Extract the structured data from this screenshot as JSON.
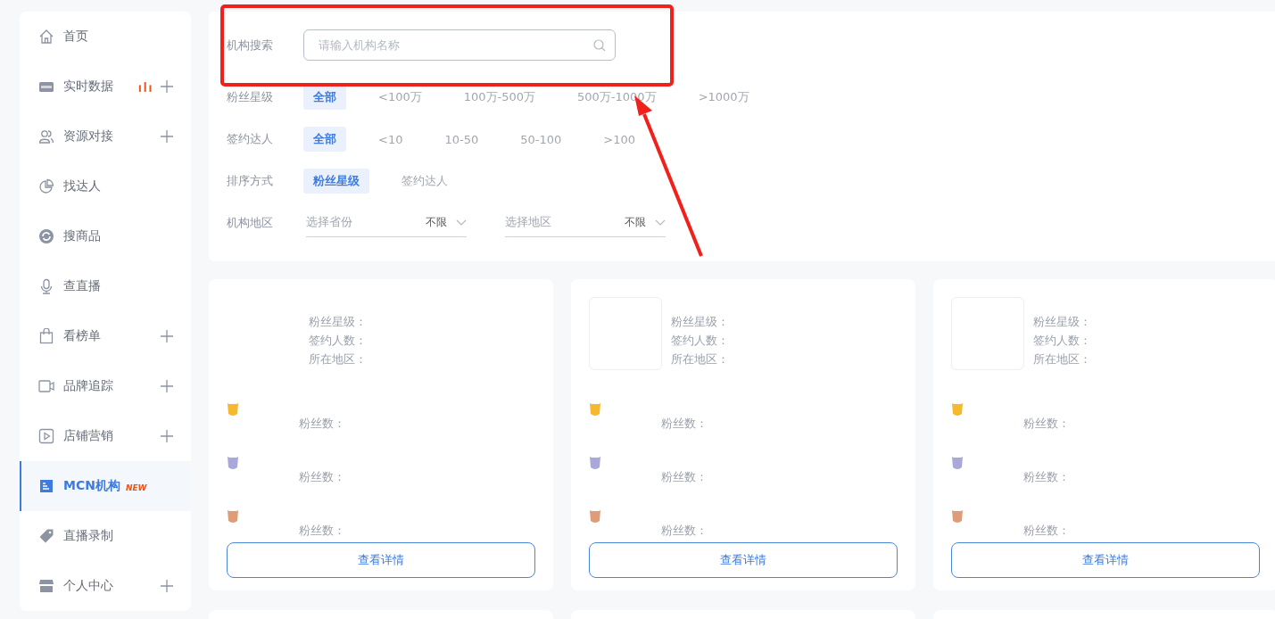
{
  "sidebar": {
    "items": [
      {
        "kind": "home",
        "label": "首页",
        "selected": false,
        "expandable": false
      },
      {
        "kind": "live",
        "label": "实时数据",
        "selected": false,
        "expandable": true
      },
      {
        "kind": "users",
        "label": "资源对接",
        "selected": false,
        "expandable": true
      },
      {
        "kind": "pie",
        "label": "找达人",
        "selected": false,
        "expandable": false
      },
      {
        "kind": "refresh",
        "label": "搜商品",
        "selected": false,
        "expandable": false
      },
      {
        "kind": "mic",
        "label": "查直播",
        "selected": false,
        "expandable": false
      },
      {
        "kind": "bag",
        "label": "看榜单",
        "selected": false,
        "expandable": true
      },
      {
        "kind": "video",
        "label": "品牌追踪",
        "selected": false,
        "expandable": true
      },
      {
        "kind": "play",
        "label": "店铺营销",
        "selected": false,
        "expandable": true
      },
      {
        "kind": "doc",
        "label": "MCN机构",
        "selected": true,
        "expandable": false,
        "badge": "NEW"
      },
      {
        "kind": "tag",
        "label": "直播录制",
        "selected": false,
        "expandable": false
      },
      {
        "kind": "shop",
        "label": "个人中心",
        "selected": false,
        "expandable": true
      }
    ]
  },
  "filters": {
    "search": {
      "label": "机构搜索",
      "placeholder": "请输入机构名称"
    },
    "option_rows": [
      {
        "label": "粉丝星级",
        "options": [
          {
            "label": "全部",
            "selected": true
          },
          {
            "label": "<100万",
            "selected": false
          },
          {
            "label": "100万-500万",
            "selected": false
          },
          {
            "label": "500万-1000万",
            "selected": false
          },
          {
            "label": ">1000万",
            "selected": false
          }
        ]
      },
      {
        "label": "签约达人",
        "options": [
          {
            "label": "全部",
            "selected": true
          },
          {
            "label": "<10",
            "selected": false
          },
          {
            "label": "10-50",
            "selected": false
          },
          {
            "label": "50-100",
            "selected": false
          },
          {
            "label": ">100",
            "selected": false
          }
        ]
      },
      {
        "label": "排序方式",
        "options": [
          {
            "label": "粉丝星级",
            "selected": true
          },
          {
            "label": "签约达人",
            "selected": false
          }
        ]
      }
    ],
    "region": {
      "label": "机构地区",
      "selects": [
        {
          "placeholder": "选择省份",
          "value": "不限"
        },
        {
          "placeholder": "选择地区",
          "value": "不限"
        }
      ]
    }
  },
  "cards": [
    {
      "avatar": false,
      "fields": [
        "粉丝星级：",
        "签约人数：",
        "所在地区："
      ],
      "ranks": [
        {
          "color": "#f5b82e",
          "label": "粉丝数："
        },
        {
          "color": "#aaa7d9",
          "label": "粉丝数："
        },
        {
          "color": "#de9d77",
          "label": "粉丝数："
        }
      ],
      "button": "查看详情"
    },
    {
      "avatar": true,
      "fields": [
        "粉丝星级：",
        "签约人数：",
        "所在地区："
      ],
      "ranks": [
        {
          "color": "#f5b82e",
          "label": "粉丝数："
        },
        {
          "color": "#aaa7d9",
          "label": "粉丝数："
        },
        {
          "color": "#de9d77",
          "label": "粉丝数："
        }
      ],
      "button": "查看详情"
    },
    {
      "avatar": true,
      "fields": [
        "粉丝星级：",
        "签约人数：",
        "所在地区："
      ],
      "ranks": [
        {
          "color": "#f5b82e",
          "label": "粉丝数："
        },
        {
          "color": "#aaa7d9",
          "label": "粉丝数："
        },
        {
          "color": "#de9d77",
          "label": "粉丝数："
        }
      ],
      "button": "查看详情"
    }
  ]
}
